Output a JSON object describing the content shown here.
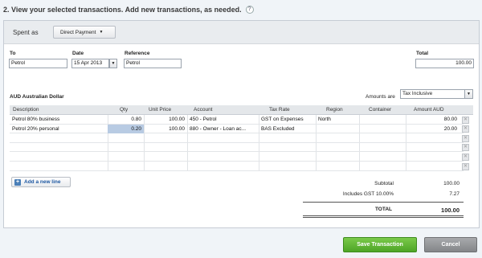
{
  "heading": "2. View your selected transactions. Add new transactions, as needed.",
  "help_icon": "?",
  "spent_as": {
    "label": "Spent as",
    "value": "Direct Payment"
  },
  "fields": {
    "to_label": "To",
    "to_value": "Petrol",
    "date_label": "Date",
    "date_value": "15 Apr 2013",
    "reference_label": "Reference",
    "reference_value": "Petrol",
    "total_label": "Total",
    "total_value": "100.00"
  },
  "currency": "AUD Australian Dollar",
  "amounts_are": {
    "label": "Amounts are",
    "value": "Tax Inclusive"
  },
  "columns": {
    "description": "Description",
    "qty": "Qty",
    "unit_price": "Unit Price",
    "account": "Account",
    "tax_rate": "Tax Rate",
    "region": "Region",
    "container": "Container",
    "amount": "Amount AUD"
  },
  "rows": [
    {
      "description": "Petrol 80% business",
      "qty": "0.80",
      "unit_price": "100.00",
      "account": "450 - Petrol",
      "tax_rate": "GST on Expenses",
      "region": "North",
      "container": "",
      "amount": "80.00"
    },
    {
      "description": "Petrol 20% personal",
      "qty": "0.20",
      "unit_price": "100.00",
      "account": "880 - Owner - Loan ac...",
      "tax_rate": "BAS Excluded",
      "region": "",
      "container": "",
      "amount": "20.00"
    }
  ],
  "add_line_label": "Add a new line",
  "totals": {
    "subtotal_label": "Subtotal",
    "subtotal_value": "100.00",
    "gst_label": "Includes GST 10.00%",
    "gst_value": "7.27",
    "total_label": "TOTAL",
    "total_value": "100.00"
  },
  "buttons": {
    "save": "Save Transaction",
    "cancel": "Cancel"
  },
  "colors": {
    "save": "#4ea526",
    "cancel": "#848689",
    "link": "#1d57a1",
    "selected_cell": "#b8cbe3"
  }
}
